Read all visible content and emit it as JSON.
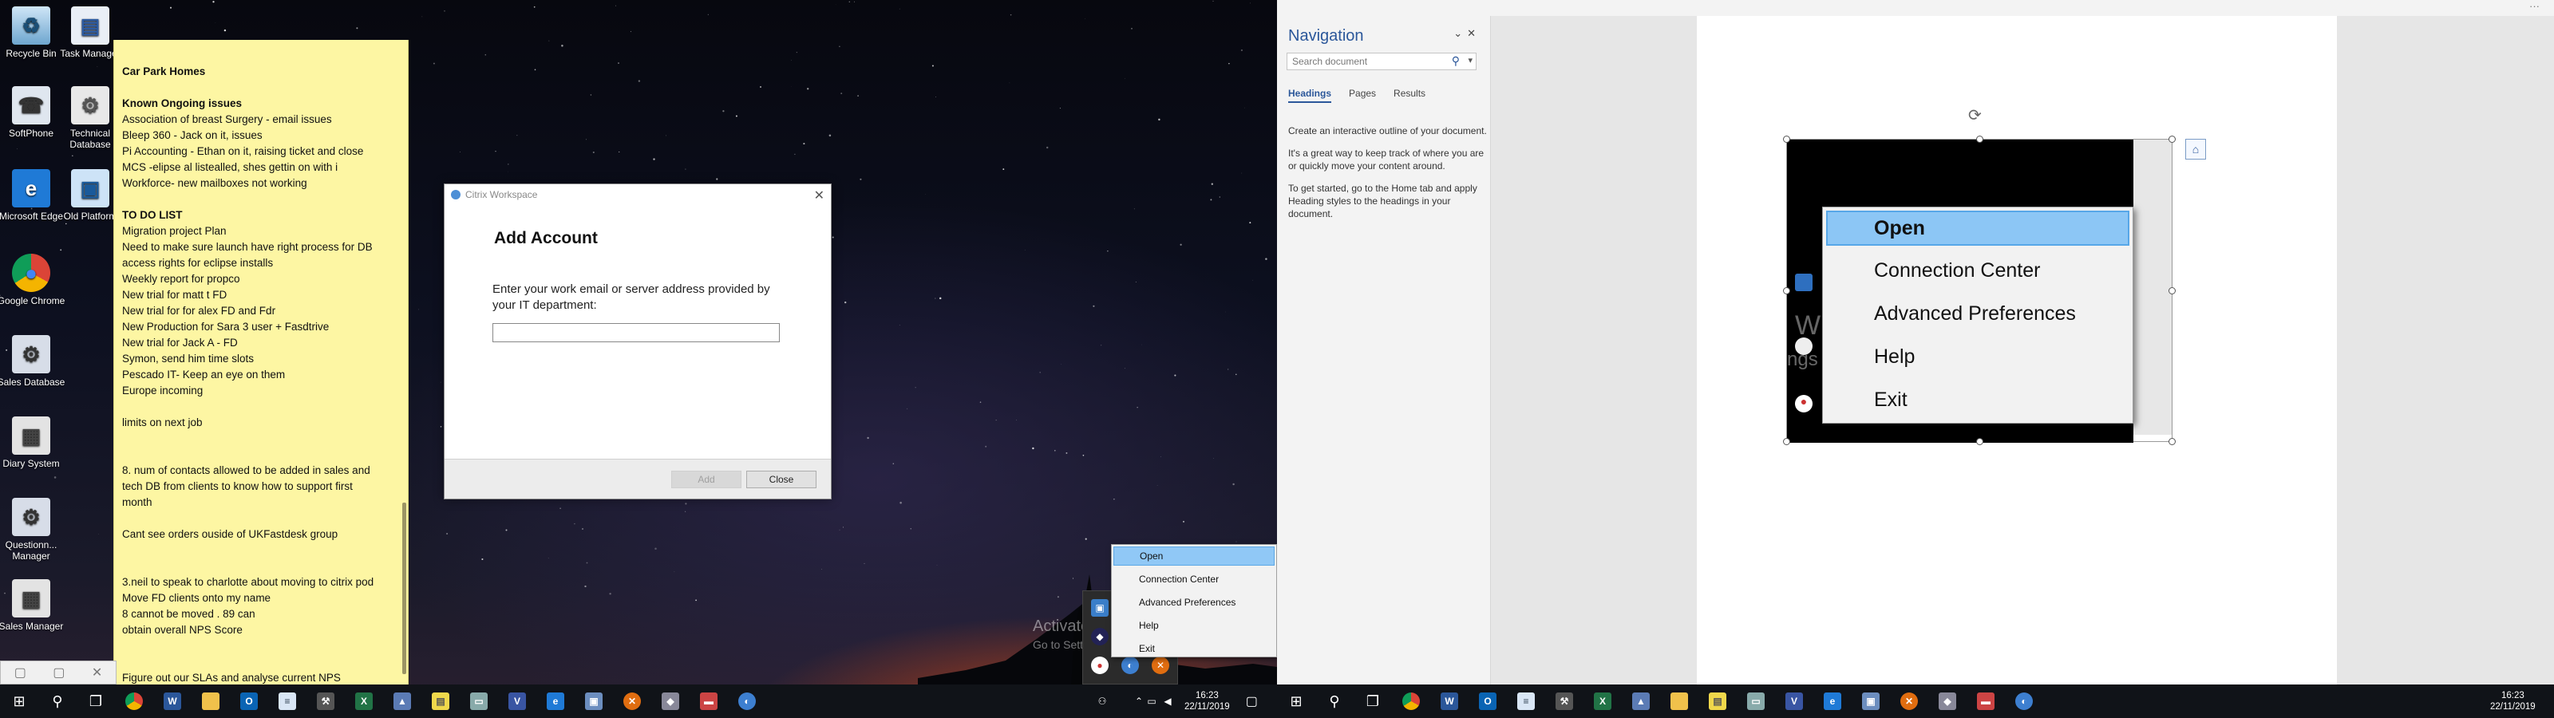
{
  "desktop_icons": [
    {
      "label": "Recycle Bin",
      "icon": "recycle-bin-icon"
    },
    {
      "label": "Task Manager",
      "icon": "task-manager-icon"
    },
    {
      "label": "SoftPhone",
      "icon": "softphone-icon"
    },
    {
      "label": "Technical Database",
      "icon": "database-icon"
    },
    {
      "label": "Microsoft Edge",
      "icon": "edge-icon"
    },
    {
      "label": "Old Platform",
      "icon": "shortcut-icon"
    },
    {
      "label": "Google Chrome",
      "icon": "chrome-icon"
    },
    {
      "label": "Sales Database",
      "icon": "database-icon"
    },
    {
      "label": "Diary System",
      "icon": "diary-icon"
    },
    {
      "label": "Questionn... Manager",
      "icon": "questionnaire-icon"
    },
    {
      "label": "Sales Manager",
      "icon": "sales-manager-icon"
    }
  ],
  "sticky_note": {
    "lines": [
      {
        "text": "Car Park Homes",
        "bold": true
      },
      {
        "text": "",
        "bold": false
      },
      {
        "text": "Known Ongoing issues",
        "bold": true
      },
      {
        "text": "Association of breast Surgery - email issues",
        "bold": false
      },
      {
        "text": "Bleep 360 - Jack on it, issues",
        "bold": false
      },
      {
        "text": "Pi Accounting - Ethan on it, raising ticket and close",
        "bold": false
      },
      {
        "text": "MCS -elipse al listealled, shes gettin on with i",
        "bold": false
      },
      {
        "text": "Workforce- new mailboxes not working",
        "bold": false
      },
      {
        "text": "",
        "bold": false
      },
      {
        "text": "TO DO LIST",
        "bold": true
      },
      {
        "text": "Migration project Plan",
        "bold": false
      },
      {
        "text": "Need to make sure launch have right process for DB",
        "bold": false
      },
      {
        "text": "access rights for eclipse installs",
        "bold": false
      },
      {
        "text": "Weekly report for propco",
        "bold": false
      },
      {
        "text": "New trial for matt t FD",
        "bold": false
      },
      {
        "text": "New trial for for alex FD and Fdr",
        "bold": false
      },
      {
        "text": "New Production for Sara 3 user + Fasdtrive",
        "bold": false
      },
      {
        "text": "New trial for Jack A - FD",
        "bold": false
      },
      {
        "text": "Symon, send him time slots",
        "bold": false
      },
      {
        "text": "Pescado IT- Keep an eye on them",
        "bold": false
      },
      {
        "text": "Europe incoming",
        "bold": false
      },
      {
        "text": "",
        "bold": false
      },
      {
        "text": "limits on next job",
        "bold": false
      },
      {
        "text": "",
        "bold": false
      },
      {
        "text": "",
        "bold": false
      },
      {
        "text": "8. num of contacts allowed to be added in sales and",
        "bold": false
      },
      {
        "text": "tech DB from clients to know how to support first",
        "bold": false
      },
      {
        "text": "month",
        "bold": false
      },
      {
        "text": "",
        "bold": false
      },
      {
        "text": "Cant see orders ouside of UKFastdesk group",
        "bold": false
      },
      {
        "text": "",
        "bold": false
      },
      {
        "text": "",
        "bold": false
      },
      {
        "text": "3.neil to speak to charlotte about moving to citrix pod",
        "bold": false
      },
      {
        "text": "Move FD clients onto my name",
        "bold": false
      },
      {
        "text": "8 cannot be moved . 89 can",
        "bold": false
      },
      {
        "text": "obtain overall NPS Score",
        "bold": false
      },
      {
        "text": "",
        "bold": false
      },
      {
        "text": "",
        "bold": false
      },
      {
        "text": "Figure out our SLAs and analyse current NPS",
        "bold": false
      }
    ],
    "toolbar": {
      "minimize": "▢",
      "restore": "▢",
      "close": "✕"
    }
  },
  "citrix_dialog": {
    "title": "Citrix Workspace",
    "heading": "Add Account",
    "prompt": "Enter your work email or server address provided by your IT department:",
    "input_value": "",
    "add_label": "Add",
    "close_label": "Close"
  },
  "context_menu": {
    "items": [
      "Open",
      "Connection Center",
      "Advanced Preferences",
      "Help",
      "Exit"
    ],
    "selected_index": 0
  },
  "activate_windows": {
    "title": "Activate Windows",
    "subtitle": "Go to Settings to activate Windows.",
    "title_partial": "Windows",
    "subtitle_partial": "ngs to activate Windows."
  },
  "taskbar_left": {
    "apps": [
      "start-icon",
      "search-icon",
      "task-view-icon",
      "chrome-icon",
      "word-icon",
      "explorer-icon",
      "outlook-icon",
      "notepad-icon",
      "tool-icon",
      "excel-icon",
      "photo-icon",
      "notes-icon",
      "rdp-icon",
      "visio-icon",
      "edge-icon",
      "network-icon",
      "stop-icon",
      "shield-icon",
      "car-icon",
      "citrix-icon"
    ],
    "time": "16:23",
    "date": "22/11/2019"
  },
  "taskbar_right": {
    "time": "16:23",
    "date": "22/11/2019"
  },
  "word": {
    "top_dots": "···",
    "navigation": {
      "title": "Navigation",
      "search_placeholder": "Search document",
      "tabs": [
        "Headings",
        "Pages",
        "Results"
      ],
      "active_tab": 0,
      "help": [
        "Create an interactive outline of your document.",
        "It's a great way to keep track of where you are or quickly move your content around.",
        "To get started, go to the Home tab and apply Heading styles to the headings in your document."
      ]
    }
  }
}
